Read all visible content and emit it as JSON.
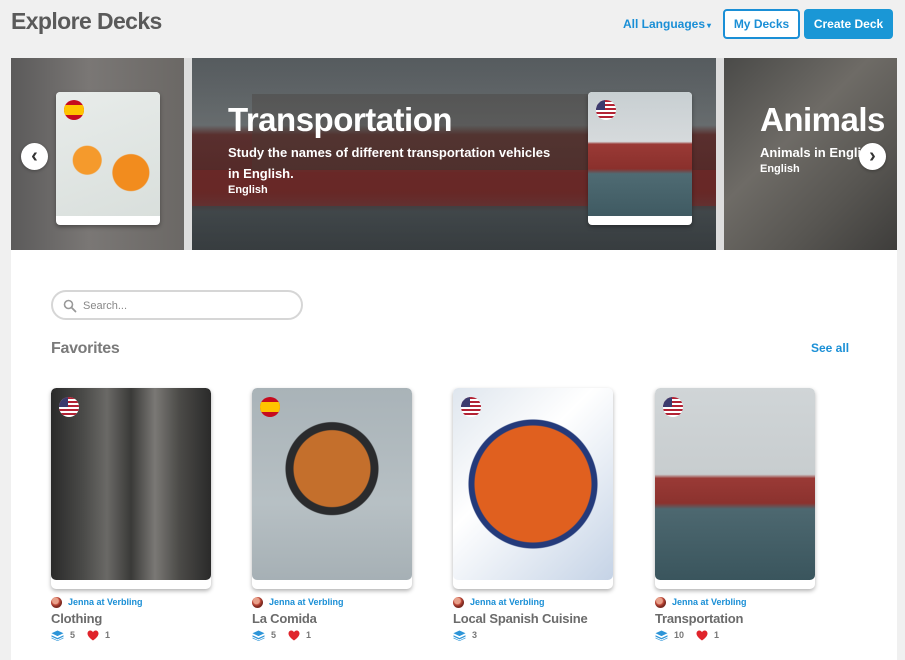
{
  "header": {
    "title": "Explore Decks",
    "language_filter": "All Languages",
    "my_decks": "My Decks",
    "create_deck": "Create Deck"
  },
  "carousel": {
    "slides": [
      {
        "title": "Transportation",
        "description": "Study the names of different transportation vehicles in English.",
        "language": "English",
        "flag": "us-flag-icon"
      },
      {
        "title": "Animals",
        "description": "Animals in English",
        "language": "English",
        "flag": "us-flag-icon"
      }
    ],
    "prev_card_flag": "spain-flag-icon",
    "active_dot": 1,
    "dot_count": 3
  },
  "search": {
    "placeholder": "Search..."
  },
  "favorites": {
    "title": "Favorites",
    "see_all": "See all",
    "decks": [
      {
        "title": "Clothing",
        "author": "Jenna at Verbling",
        "cards": "5",
        "likes": "1",
        "flag": "us-flag-icon"
      },
      {
        "title": "La Comida",
        "author": "Jenna at Verbling",
        "cards": "5",
        "likes": "1",
        "flag": "spain-flag-icon"
      },
      {
        "title": "Local Spanish Cuisine",
        "author": "Jenna at Verbling",
        "cards": "3",
        "likes": "",
        "flag": "us-flag-icon"
      },
      {
        "title": "Transportation",
        "author": "Jenna at Verbling",
        "cards": "10",
        "likes": "1",
        "flag": "us-flag-icon"
      }
    ]
  },
  "colors": {
    "accent": "#1a8fd6",
    "heart": "#e0242b"
  }
}
